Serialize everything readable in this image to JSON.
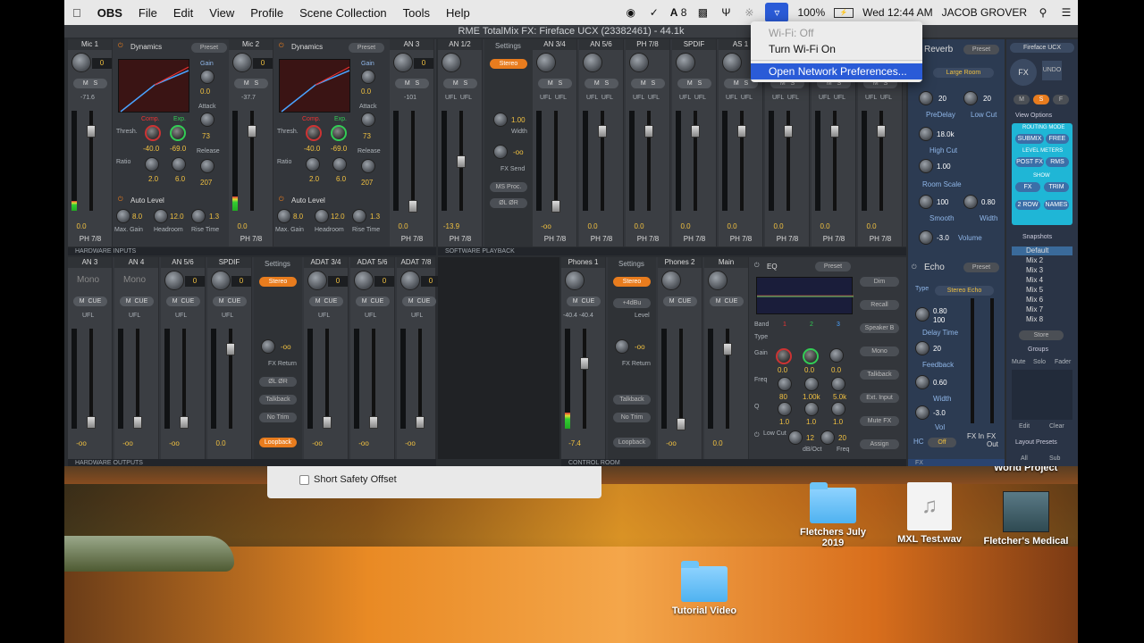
{
  "menubar": {
    "apple": "",
    "app_name": "OBS",
    "items": [
      "File",
      "Edit",
      "View",
      "Profile",
      "Scene Collection",
      "Tools",
      "Help"
    ],
    "status": {
      "adobe_count": "8",
      "battery": "100%",
      "datetime": "Wed 12:44 AM",
      "user": "JACOB GROVER"
    }
  },
  "wifi_menu": {
    "status": "Wi-Fi: Off",
    "turn_on": "Turn Wi-Fi On",
    "open_prefs": "Open Network Preferences..."
  },
  "rme": {
    "title": "RME TotalMix FX: Fireface UCX (23382461) - 44.1k",
    "sections": {
      "hardware_inputs": "HARDWARE INPUTS",
      "software_playback": "SOFTWARE PLAYBACK",
      "hardware_outputs": "HARDWARE OUTPUTS",
      "control_room": "CONTROL ROOM",
      "fx": "FX"
    },
    "inputs": [
      {
        "name": "Mic 1",
        "gain": "0",
        "pan_db": "-71.6",
        "level": "0.0",
        "route": "PH 7/8"
      },
      {
        "name": "Mic 2",
        "gain": "0",
        "pan_db": "-37.7",
        "level": "0.0",
        "route": "PH 7/8"
      },
      {
        "name": "AN 3",
        "gain": "0",
        "pan_db": "-101",
        "level": "0.0",
        "route": "PH 7/8"
      }
    ],
    "dynamics": {
      "label": "Dynamics",
      "preset": "Preset",
      "gain_label": "Gain",
      "gain_val": "0.0",
      "attack_label": "Attack",
      "attack_val": "73",
      "release_label": "Release",
      "release_val": "207",
      "comp": "Comp.",
      "exp": "Exp.",
      "thresh": "Thresh.",
      "thresh_comp": "-40.0",
      "thresh_exp": "-69.0",
      "ratio": "Ratio",
      "ratio_comp": "2.0",
      "ratio_exp": "6.0",
      "auto_level": "Auto Level",
      "max_gain_label": "Max. Gain",
      "max_gain": "8.0",
      "headroom_label": "Headroom",
      "headroom": "12.0",
      "rise_label": "Rise Time",
      "rise": "1.3"
    },
    "playback": [
      {
        "name": "AN 1/2",
        "level": "-13.9",
        "route": "PH 7/8"
      },
      {
        "name": "AN 3/4",
        "level": "-oo",
        "route": "PH 7/8"
      },
      {
        "name": "AN 5/6",
        "level": "0.0",
        "route": "PH 7/8"
      },
      {
        "name": "PH 7/8",
        "level": "0.0",
        "route": "PH 7/8"
      },
      {
        "name": "SPDIF",
        "level": "0.0",
        "route": "PH 7/8"
      },
      {
        "name": "AS 1",
        "level": "0.0",
        "route": "PH 7/8"
      },
      {
        "name": "",
        "level": "0.0",
        "route": "PH 7/8"
      },
      {
        "name": "",
        "level": "0.0",
        "route": "PH 7/8"
      },
      {
        "name": "",
        "level": "0.0",
        "route": "PH 7/8"
      }
    ],
    "playback_settings": {
      "settings": "Settings",
      "stereo": "Stereo",
      "width_val": "1.00",
      "width_label": "Width",
      "fxsend_val": "-oo",
      "fxsend_label": "FX Send",
      "msproc": "MS Proc.",
      "lr": "ØL ØR"
    },
    "outputs": [
      {
        "name": "AN 3",
        "top": "Mono",
        "level": "-oo"
      },
      {
        "name": "AN 4",
        "top": "Mono",
        "level": "-oo"
      },
      {
        "name": "AN 5/6",
        "top": "0",
        "level": "-oo"
      },
      {
        "name": "SPDIF",
        "top": "0",
        "level": "0.0"
      },
      {
        "name": "ADAT 3/4",
        "top": "0",
        "level": "-oo"
      },
      {
        "name": "ADAT 5/6",
        "top": "0",
        "level": "-oo"
      },
      {
        "name": "ADAT 7/8",
        "top": "0",
        "level": "-oo"
      }
    ],
    "output_settings": {
      "settings": "Settings",
      "stereo": "Stereo",
      "fx_return_val": "-oo",
      "fx_return": "FX Return",
      "lr": "ØL ØR",
      "talkback": "Talkback",
      "notrim": "No Trim",
      "loopback": "Loopback"
    },
    "control_room": [
      {
        "name": "Phones 1",
        "level": "-7.4",
        "meter": "-40.4 -40.4"
      },
      {
        "name": "Phones 2",
        "level": "-oo"
      },
      {
        "name": "Main",
        "level": "0.0"
      }
    ],
    "cr_settings": {
      "settings": "Settings",
      "stereo": "Stereo",
      "level_val": "+4dBu",
      "level_label": "Level",
      "fx_return_val": "-oo",
      "fx_return": "FX Return",
      "talkback": "Talkback",
      "notrim": "No Trim",
      "loopback": "Loopback"
    },
    "eq": {
      "label": "EQ",
      "preset": "Preset",
      "band_label": "Band",
      "bands": [
        "1",
        "2",
        "3"
      ],
      "type_label": "Type",
      "gain_label": "Gain",
      "gain_vals": [
        "0.0",
        "0.0",
        "0.0"
      ],
      "freq_label": "Freq",
      "freq_vals": [
        "80",
        "1.00k",
        "5.0k"
      ],
      "q_label": "Q",
      "q_vals": [
        "1.0",
        "1.0",
        "1.0"
      ],
      "lowcut_label": "Low Cut",
      "lowcut_db": "12",
      "lowcut_unit": "dB/Oct",
      "lowcut_freq": "20",
      "freq_unit": "Freq"
    },
    "cr_buttons": [
      "Dim",
      "Recall",
      "Speaker B",
      "Mono",
      "Talkback",
      "Ext. Input",
      "Mute FX",
      "Assign"
    ],
    "reverb": {
      "label": "Reverb",
      "preset": "Preset",
      "type": "Large Room",
      "predelay": "20",
      "predelay_label": "PreDelay",
      "lowcut": "20",
      "lowcut_label": "Low Cut",
      "highcut": "18.0k",
      "highcut_label": "High Cut",
      "roomscale": "1.00",
      "roomscale_label": "Room Scale",
      "smooth": "100",
      "smooth_label": "Smooth",
      "width": "0.80",
      "width_label": "Width",
      "volume": "-3.0",
      "volume_label": "Volume"
    },
    "echo": {
      "label": "Echo",
      "preset": "Preset",
      "type_label": "Type",
      "type": "Stereo Echo",
      "delay": "0.80",
      "delay_sub": "100",
      "delay_label": "Delay Time",
      "feedback": "20",
      "feedback_label": "Feedback",
      "width": "0.60",
      "width_label": "Width",
      "vol": "-3.0",
      "vol_label": "Vol",
      "hc_label": "HC",
      "hc": "Off",
      "fx_in": "FX In",
      "fx_out": "FX Out"
    },
    "sidebar": {
      "device": "Fireface UCX",
      "fx_btn": "FX",
      "undo": "UNDO",
      "msf": [
        "M",
        "S",
        "F"
      ],
      "view_options": "View Options",
      "routing_mode": "ROUTING MODE",
      "submix": "SUBMIX",
      "free": "FREE",
      "level_meters": "LEVEL METERS",
      "post_fx": "POST FX",
      "rms": "RMS",
      "show": "SHOW",
      "fx": "FX",
      "trim": "TRIM",
      "two_row": "2 ROW",
      "names": "NAMES",
      "snapshots": "Snapshots",
      "snapshot_items": [
        "Default",
        "Mix 2",
        "Mix 3",
        "Mix 4",
        "Mix 5",
        "Mix 6",
        "Mix 7",
        "Mix 8"
      ],
      "store": "Store",
      "groups": "Groups",
      "group_cols": [
        "Mute",
        "Solo",
        "Fader"
      ],
      "edit": "Edit",
      "clear": "Clear",
      "layout_presets": "Layout Presets",
      "all": "All",
      "sub": "Sub"
    }
  },
  "safety": {
    "label": "Short Safety Offset"
  },
  "desktop": {
    "partial_label": "World Project",
    "icons": [
      {
        "label": "Fletchers July 2019",
        "kind": "folder"
      },
      {
        "label": "MXL Test.wav",
        "kind": "audio"
      },
      {
        "label": "Fletcher's Medical",
        "kind": "app"
      },
      {
        "label": "Tutorial Video",
        "kind": "folder"
      }
    ]
  }
}
